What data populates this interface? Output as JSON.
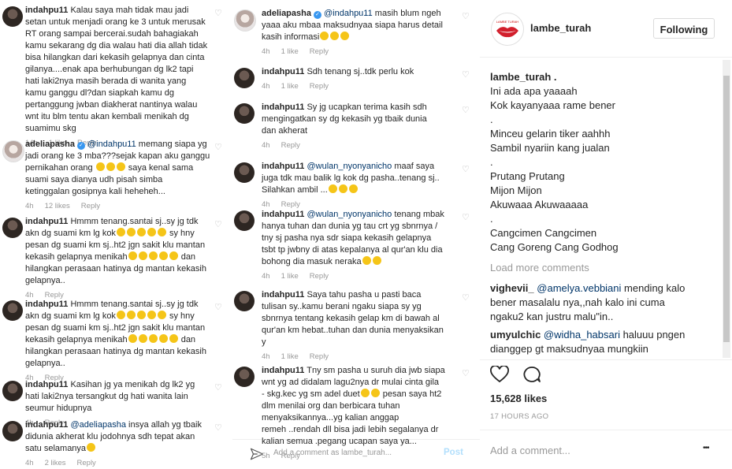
{
  "col1": {
    "comments": [
      {
        "user": "indahpu11",
        "avatar": "user",
        "lines": [
          "Kalau saya mah tidak mau jadi",
          "setan untuk menjadi orang ke 3 untuk merusak",
          "RT orang sampai bercerai.sudah bahagiakah",
          "kamu sekarang dg dia walau hati dia allah tidak",
          "bisa hilangkan dari kekasih gelapnya dan cinta",
          "gilanya....enak apa berhubungan dg lk2 tapi",
          "hati laki2nya masih berada di wanita yang",
          "kamu ganggu dl?dan siapkah kamu dg",
          "pertanggung jwban diakherat nantinya walau",
          "wnt itu blm tentu akan kembali menikah dg",
          "suamimu skg"
        ],
        "time": "14h",
        "likes": "1 like",
        "reply": "Reply"
      },
      {
        "user": "adeliapasha",
        "avatar": "ade",
        "lines": [
          "@indahpu11 memang siapa yg",
          "jadi orang ke 3 mba???sejak kapan aku ganggu",
          "pernikahan orang 😂😂😂 saya kenal sama",
          "suami saya dianya udh pisah simba",
          "ketinggalan gosipnya kali heheheh..."
        ],
        "time": "4h",
        "likes": "12 likes",
        "reply": "Reply"
      },
      {
        "user": "indahpu11",
        "avatar": "user",
        "lines": [
          "Hmmm tenang.santai sj..sy jg tdk",
          "akn dg suami km lg kok😂😂😂😂😂 sy hny",
          "pesan dg suami km sj..ht2 jgn sakit klu mantan",
          "kekasih gelapnya menikah😂😂😂😂😂 dan",
          "hilangkan perasaan hatinya dg mantan kekasih",
          "gelapnya.."
        ],
        "time": "4h",
        "likes": "",
        "reply": "Reply"
      },
      {
        "user": "indahpu11",
        "avatar": "user",
        "lines": [
          "Hmmm tenang.santai sj..sy jg tdk",
          "akn dg suami km lg kok😂😂😂😂😂 sy hny",
          "pesan dg suami km sj..ht2 jgn sakit klu mantan",
          "kekasih gelapnya menikah😂😂😂😂😂 dan",
          "hilangkan perasaan hatinya dg mantan kekasih",
          "gelapnya.."
        ],
        "time": "4h",
        "likes": "",
        "reply": "Reply"
      },
      {
        "user": "indahpu11",
        "avatar": "user",
        "lines": [
          "Kasihan jg ya menikah dg lk2 yg",
          "hati laki2nya tersangkut dg hati wanita lain",
          "seumur hidupnya"
        ],
        "time": "4h",
        "likes": "",
        "reply": "Reply"
      },
      {
        "user": "indahpu11",
        "avatar": "user",
        "lines": [
          "@adeliapasha insya allah yg tbaik",
          "didunia akherat klu jodohnya sdh tepat akan",
          "satu selamanya😉"
        ],
        "time": "4h",
        "likes": "2 likes",
        "reply": "Reply"
      }
    ]
  },
  "col2": {
    "comments": [
      {
        "user": "adeliapasha",
        "avatar": "ade",
        "lines": [
          "@indahpu11 masih blum ngeh",
          "yaaa aku mbaa maksudnyaa siapa harus detail",
          "kasih informasi😂😂😂"
        ],
        "time": "4h",
        "likes": "1 like",
        "reply": "Reply"
      },
      {
        "user": "indahpu11",
        "avatar": "user",
        "lines": [
          "Sdh tenang sj..tdk perlu kok"
        ],
        "time": "4h",
        "likes": "1 like",
        "reply": "Reply"
      },
      {
        "user": "indahpu11",
        "avatar": "user",
        "lines": [
          "Sy jg ucapkan terima kasih sdh",
          "mengingatkan sy dg kekasih yg tbaik dunia",
          "dan akherat"
        ],
        "time": "4h",
        "likes": "",
        "reply": "Reply"
      },
      {
        "user": "indahpu11",
        "avatar": "user",
        "lines": [
          "@wulan_nyonyanicho maaf saya",
          "juga tdk mau balik lg kok dg pasha..tenang sj..",
          "Silahkan ambil ...😀😀😀"
        ],
        "time": "4h",
        "likes": "",
        "reply": "Reply"
      },
      {
        "user": "indahpu11",
        "avatar": "user",
        "lines": [
          "@wulan_nyonyanicho tenang mbak",
          "hanya tuhan dan dunia yg tau crt yg sbnrnya /",
          "tny sj pasha nya sdr siapa kekasih gelapnya",
          "tsbt tp jwbny di atas kepalanya al qur'an klu dia",
          "bohong dia masuk neraka😀😀"
        ],
        "time": "4h",
        "likes": "1 like",
        "reply": "Reply"
      },
      {
        "user": "indahpu11",
        "avatar": "user",
        "lines": [
          "Saya tahu pasha u pasti baca",
          "tulisan sy..kamu berani ngaku siapa sy yg",
          "sbnrnya tentang kekasih gelap km di bawah al",
          "qur'an km hebat..tuhan dan dunia menyaksikan",
          "y"
        ],
        "time": "4h",
        "likes": "1 like",
        "reply": "Reply"
      },
      {
        "user": "indahpu11",
        "avatar": "user",
        "lines": [
          "Tny sm pasha u suruh dia jwb siapa",
          "wnt yg ad didalam lagu2nya dr mulai cinta gila",
          "- skg.kec yg sm adel duet😀😀 pesan saya ht2",
          "dlm menilai org dan berbicara tuhan",
          "menyaksikannya...yg kalian anggap",
          "remeh ..rendah dll bisa jadi lebih segalanya dr",
          "kalian semua .pegang ucapan saya ya..."
        ],
        "time": "5h",
        "likes": "",
        "reply": "Reply"
      }
    ],
    "add_comment_placeholder": "Add a comment as lambe_turah...",
    "post_label": "Post"
  },
  "col3": {
    "username": "lambe_turah",
    "follow_label": "Following",
    "caption_user": "lambe_turah",
    "caption_lines": [
      "Ini ada apa yaaaah",
      "Kok kayanyaaa rame bener",
      ".",
      "Minceu gelarin tiker aahhh",
      "Sambil nyariin kang jualan",
      ".",
      "Prutang Prutang",
      "Mijon Mijon",
      "Akuwaaa Akuwaaaaa",
      ".",
      "Cangcimen Cangcimen",
      "Cang Goreng Cang Godhog"
    ],
    "load_more": "Load more comments",
    "comments": [
      {
        "user": "vighevii_",
        "mention": "@amelya.vebbiani",
        "text": " mending kalo",
        "line2": "bener masalalu nya,,nah kalo ini cuma",
        "line3": "ngaku2 kan justru malu\"in.."
      },
      {
        "user": "umyulchic",
        "mention": "@widha_habsari",
        "text": " haluuu pngen",
        "line2": "dianggep gt maksudnyaa mungkiin",
        "line3": ""
      }
    ],
    "likes": "15,628 likes",
    "posted": "17 HOURS AGO",
    "add_comment": "Add a comment...",
    "more": "•••"
  },
  "icons": [
    "heart-icon",
    "comment-icon",
    "send-icon",
    "more-icon",
    "verified-icon"
  ]
}
